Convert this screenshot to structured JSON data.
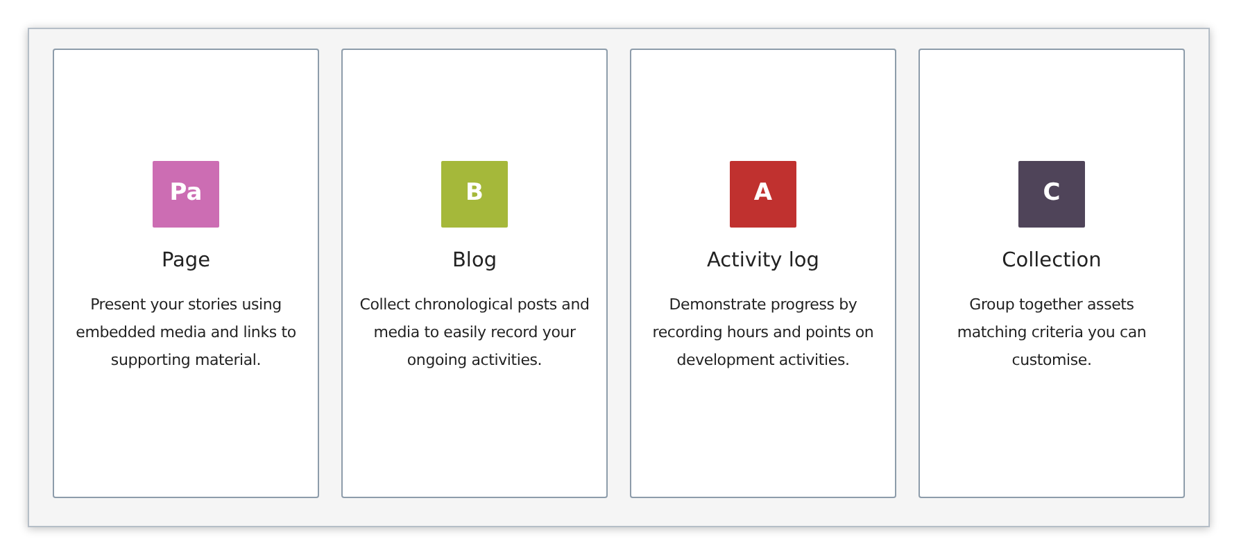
{
  "cards": [
    {
      "icon_text": "Pa",
      "color": "#cc6db3",
      "title": "Page",
      "description": "Present your stories using embedded media and links to supporting material."
    },
    {
      "icon_text": "B",
      "color": "#a5b83a",
      "title": "Blog",
      "description": "Collect chronological posts and media to easily record your ongoing activities."
    },
    {
      "icon_text": "A",
      "color": "#c0312f",
      "title": "Activity log",
      "description": "Demonstrate progress by recording hours and points on development activities."
    },
    {
      "icon_text": "C",
      "color": "#4f4459",
      "title": "Collection",
      "description": "Group together assets matching criteria you can customise."
    }
  ]
}
